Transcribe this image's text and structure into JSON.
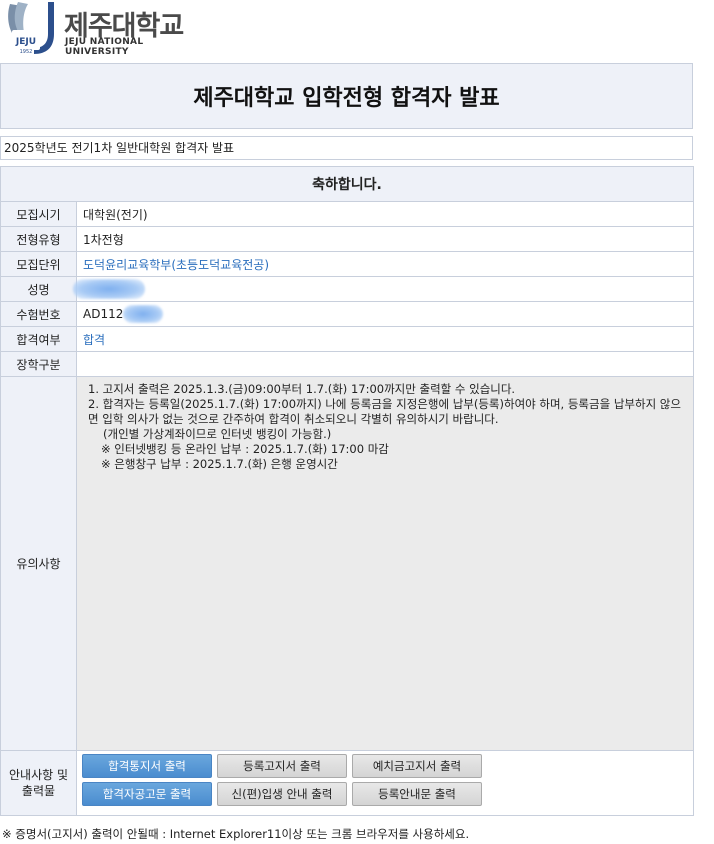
{
  "logo": {
    "name_kr": "제주대학교",
    "name_en": "JEJU NATIONAL UNIVERSITY",
    "emblem_text": "JEJU",
    "emblem_year": "1952"
  },
  "title": "제주대학교 입학전형 합격자 발표",
  "subtitle": "2025학년도 전기1차 일반대학원 합격자 발표",
  "congrats": "축하합니다.",
  "rows": [
    {
      "label": "모집시기",
      "value": "대학원(전기)"
    },
    {
      "label": "전형유형",
      "value": "1차전형"
    },
    {
      "label": "모집단위",
      "value": "도덕윤리교육학부(초등도덕교육전공)"
    },
    {
      "label": "성명",
      "value": ""
    },
    {
      "label": "수험번호",
      "value": "AD112"
    },
    {
      "label": "합격여부",
      "value": "합격"
    },
    {
      "label": "장학구분",
      "value": ""
    }
  ],
  "notes": {
    "label": "유의사항",
    "lines": [
      "1. 고지서 출력은 2025.1.3.(금)09:00부터 1.7.(화) 17:00까지만 출력할 수 있습니다.",
      "2. 합격자는 등록일(2025.1.7.(화) 17:00까지) 나에 등록금을 지정은행에 납부(등록)하여야 하며, 등록금을 납부하지 않으면 입학 의사가 없는 것으로 간주하여 합격이 취소되오니 각별히 유의하시기 바랍니다.",
      "(개인별 가상계좌이므로 인터넷 뱅킹이 가능함.)",
      "※ 인터넷뱅킹 등 온라인 납부 : 2025.1.7.(화) 17:00 마감",
      "※ 은행창구 납부 : 2025.1.7.(화) 은행 운영시간"
    ]
  },
  "buttons": {
    "label_line1": "안내사항 및",
    "label_line2": "출력물",
    "items": [
      "합격통지서 출력",
      "등록고지서 출력",
      "예치금고지서 출력",
      "합격자공고문 출력",
      "신(편)입생 안내 출력",
      "등록안내문 출력"
    ]
  },
  "footnote": "※ 증명서(고지서) 출력이 안될때 : Internet Explorer11이상 또는 크롬 브라우저를 사용하세요.",
  "colors": {
    "header_bg": "#eef1f8",
    "border": "#c8cfdc",
    "link": "#2a6ebd",
    "primary_button": "#4a8ccf"
  }
}
